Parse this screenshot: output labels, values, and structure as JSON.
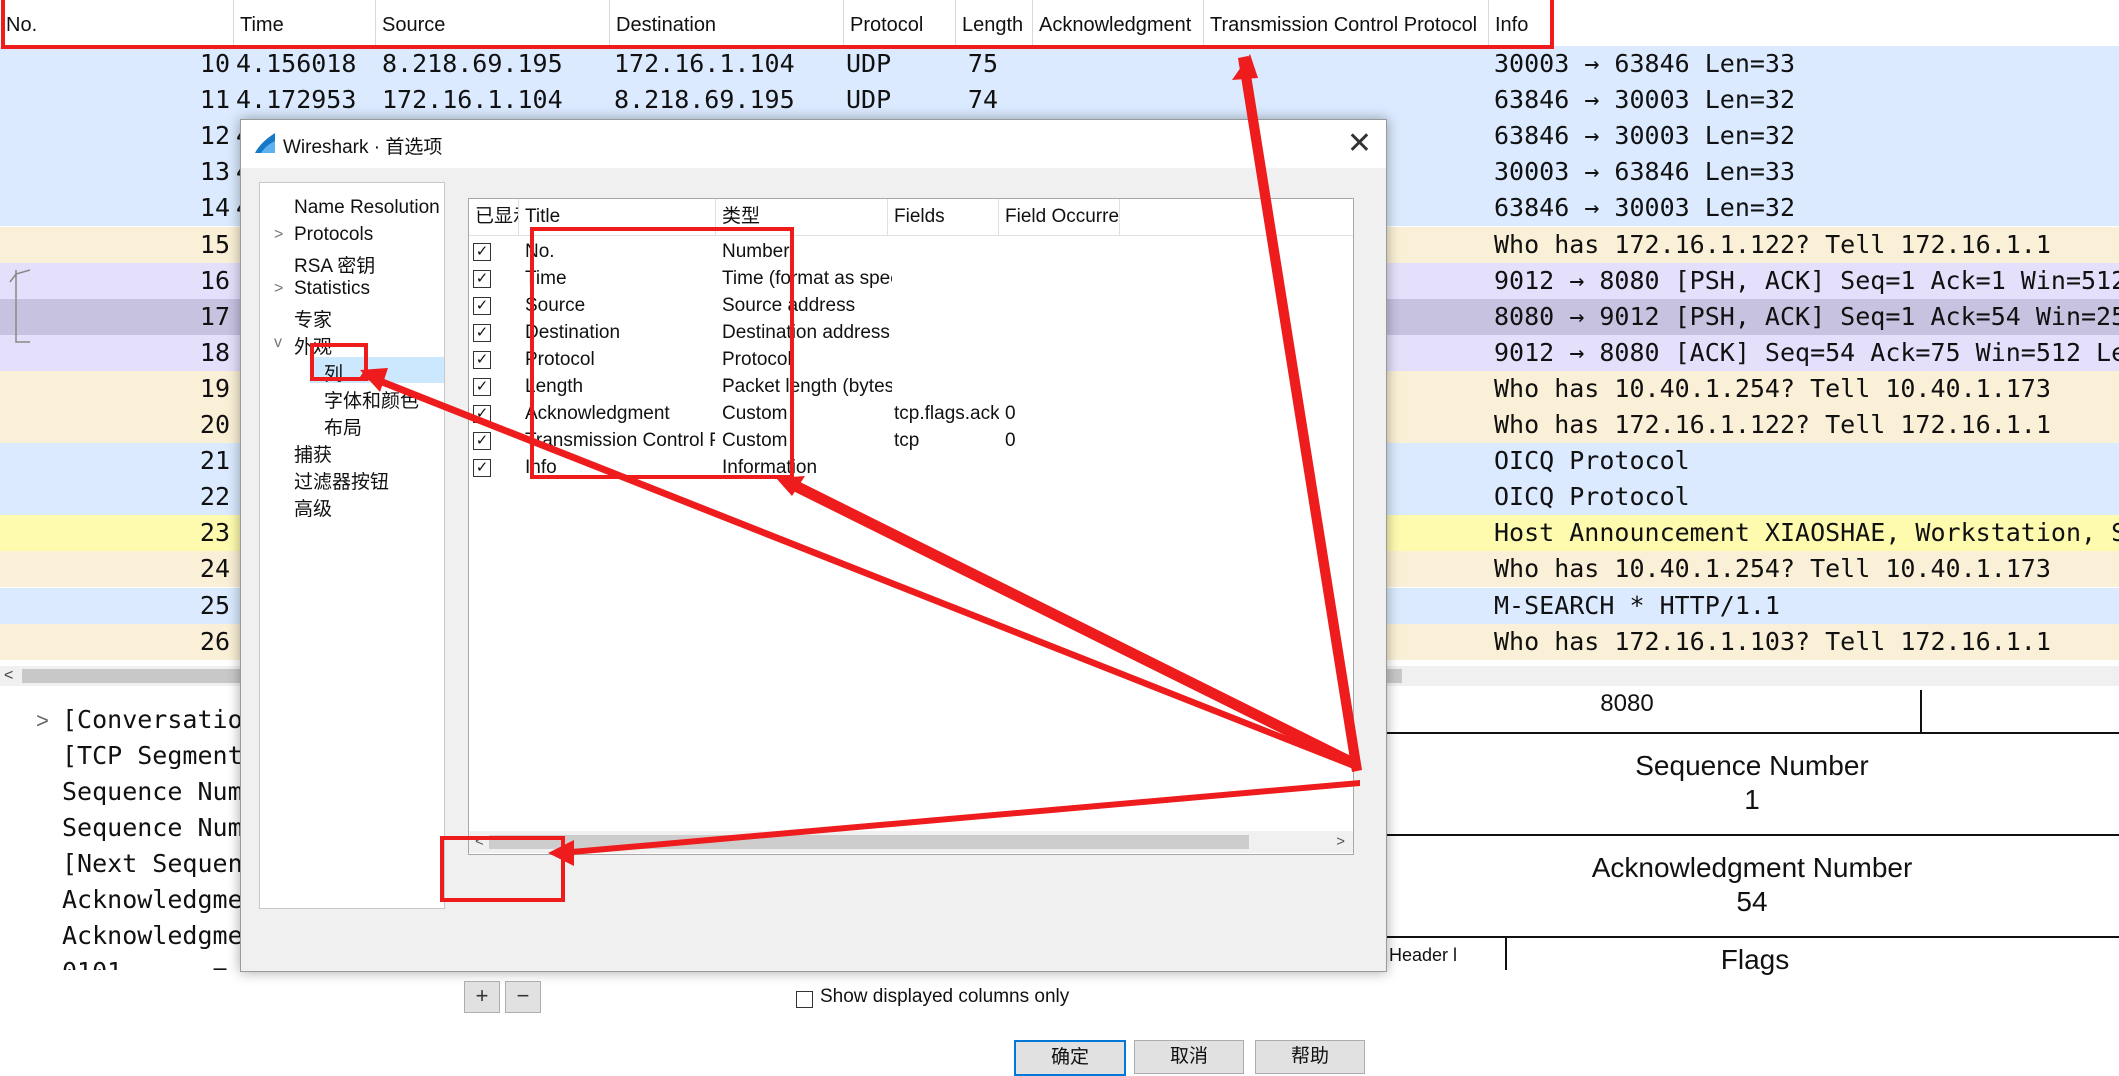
{
  "packet_list": {
    "columns": [
      "No.",
      "Time",
      "Source",
      "Destination",
      "Protocol",
      "Length",
      "Acknowledgment",
      "Transmission Control Protocol",
      "Info"
    ],
    "rows": [
      {
        "no": "10",
        "time": "4.156018",
        "source": "8.218.69.195",
        "destination": "172.16.1.104",
        "protocol": "UDP",
        "length": "75",
        "info": "30003 → 63846 Len=33",
        "color": "#dbeaff"
      },
      {
        "no": "11",
        "time": "4.172953",
        "source": "172.16.1.104",
        "destination": "8.218.69.195",
        "protocol": "UDP",
        "length": "74",
        "info": "63846 → 30003 Len=32",
        "color": "#dbeaff"
      },
      {
        "no": "12",
        "time": "4",
        "source": "",
        "destination": "",
        "protocol": "",
        "length": "",
        "info": "63846 → 30003 Len=32",
        "color": "#dbeaff"
      },
      {
        "no": "13",
        "time": "4",
        "source": "",
        "destination": "",
        "protocol": "",
        "length": "",
        "info": "30003 → 63846 Len=33",
        "color": "#dbeaff"
      },
      {
        "no": "14",
        "time": "4",
        "source": "",
        "destination": "",
        "protocol": "",
        "length": "",
        "info": "63846 → 30003 Len=32",
        "color": "#dbeaff"
      },
      {
        "no": "15",
        "time": "",
        "source": "",
        "destination": "",
        "protocol": "",
        "length": "",
        "info": "Who has 172.16.1.122? Tell 172.16.1.1",
        "color": "#faf0d7"
      },
      {
        "no": "16",
        "time": "",
        "source": "",
        "destination": "",
        "protocol": "",
        "length": "",
        "info": "9012 → 8080 [PSH, ACK] Seq=1 Ack=1 Win=512",
        "color": "#e4e0fc"
      },
      {
        "no": "17",
        "time": "",
        "source": "",
        "destination": "",
        "protocol": "",
        "length": "",
        "info": "8080 → 9012 [PSH, ACK] Seq=1 Ack=54 Win=25:",
        "color": "#c6c2e0"
      },
      {
        "no": "18",
        "time": "",
        "source": "",
        "destination": "",
        "protocol": "",
        "length": "",
        "info": "9012 → 8080 [ACK] Seq=54 Ack=75 Win=512 Len",
        "color": "#e4e0fc"
      },
      {
        "no": "19",
        "time": "",
        "source": "",
        "destination": "",
        "protocol": "",
        "length": "",
        "info": "Who has 10.40.1.254? Tell 10.40.1.173",
        "color": "#faf0d7"
      },
      {
        "no": "20",
        "time": "",
        "source": "",
        "destination": "",
        "protocol": "",
        "length": "",
        "info": "Who has 172.16.1.122? Tell 172.16.1.1",
        "color": "#faf0d7"
      },
      {
        "no": "21",
        "time": "",
        "source": "",
        "destination": "",
        "protocol": "",
        "length": "",
        "info": "OICQ Protocol",
        "color": "#dbeaff"
      },
      {
        "no": "22",
        "time": "",
        "source": "",
        "destination": "",
        "protocol": "",
        "length": "",
        "info": "OICQ Protocol",
        "color": "#dbeaff"
      },
      {
        "no": "23",
        "time": "",
        "source": "",
        "destination": "",
        "protocol": "",
        "length": "",
        "info": "Host Announcement XIAOSHAE, Workstation, Se",
        "color": "#fefbaf"
      },
      {
        "no": "24",
        "time": "",
        "source": "",
        "destination": "",
        "protocol": "",
        "length": "",
        "info": "Who has 10.40.1.254? Tell 10.40.1.173",
        "color": "#faf0d7"
      },
      {
        "no": "25",
        "time": "",
        "source": "",
        "destination": "",
        "protocol": "",
        "length": "",
        "info": "M-SEARCH * HTTP/1.1",
        "color": "#dbeaff"
      },
      {
        "no": "26",
        "time": "",
        "source": "",
        "destination": "",
        "protocol": "",
        "length": "",
        "info": "Who has 172.16.1.103? Tell 172.16.1.1",
        "color": "#faf0d7"
      }
    ],
    "scroll_left_glyph": "<"
  },
  "details": {
    "expand_glyph": ">",
    "lines": [
      "[Conversatio",
      "[TCP Segment",
      "Sequence Num",
      "Sequence Num",
      "[Next Sequen",
      "Acknowledgme",
      "Acknowledgme",
      "0101 .... = "
    ]
  },
  "diagram": {
    "port_text": "8080",
    "seq_label": "Sequence Number",
    "seq_value": "1",
    "ack_label": "Acknowledgment Number",
    "ack_value": "54",
    "header_text": "Header l",
    "flags_text": "Flags"
  },
  "dialog": {
    "title": "Wireshark · 首选项",
    "close_glyph": "✕",
    "tree": [
      {
        "label": "Name Resolution",
        "chevron": ""
      },
      {
        "label": "Protocols",
        "chevron": ">"
      },
      {
        "label": "RSA 密钥",
        "chevron": ""
      },
      {
        "label": "Statistics",
        "chevron": ">"
      },
      {
        "label": "专家",
        "chevron": ""
      },
      {
        "label": "外观",
        "chevron": "v"
      },
      {
        "label": "列",
        "chevron": "",
        "child": true,
        "selected": true
      },
      {
        "label": "字体和颜色",
        "chevron": "",
        "child": true
      },
      {
        "label": "布局",
        "chevron": "",
        "child": true
      },
      {
        "label": "捕获",
        "chevron": ""
      },
      {
        "label": "过滤器按钮",
        "chevron": ""
      },
      {
        "label": "高级",
        "chevron": ""
      }
    ],
    "tree_scroll_left": "<",
    "tree_scroll_right": ">",
    "columns_table": {
      "headers": [
        "已显示",
        "Title",
        "类型",
        "Fields",
        "Field Occurrence"
      ],
      "rows": [
        {
          "title": "No.",
          "type": "Number",
          "fields": "",
          "occurrence": "",
          "checked": "✓"
        },
        {
          "title": "Time",
          "type": "Time (format as specified)",
          "fields": "",
          "occurrence": "",
          "checked": "✓"
        },
        {
          "title": "Source",
          "type": "Source address",
          "fields": "",
          "occurrence": "",
          "checked": "✓"
        },
        {
          "title": "Destination",
          "type": "Destination address",
          "fields": "",
          "occurrence": "",
          "checked": "✓"
        },
        {
          "title": "Protocol",
          "type": "Protocol",
          "fields": "",
          "occurrence": "",
          "checked": "✓"
        },
        {
          "title": "Length",
          "type": "Packet length (bytes)",
          "fields": "",
          "occurrence": "",
          "checked": "✓"
        },
        {
          "title": "Acknowledgment",
          "type": "Custom",
          "fields": "tcp.flags.ack",
          "occurrence": "0",
          "checked": "✓"
        },
        {
          "title": "Transmission Control Protocol",
          "type": "Custom",
          "fields": "tcp",
          "occurrence": "0",
          "checked": "✓"
        },
        {
          "title": "Info",
          "type": "Information",
          "fields": "",
          "occurrence": "",
          "checked": "✓"
        }
      ],
      "scroll_left": "<",
      "scroll_right": ">"
    },
    "add_glyph": "+",
    "remove_glyph": "−",
    "show_displayed_only": "Show displayed columns only",
    "ok": "确定",
    "cancel": "取消",
    "help": "帮助"
  },
  "annotation_color": "#ee1c1c"
}
